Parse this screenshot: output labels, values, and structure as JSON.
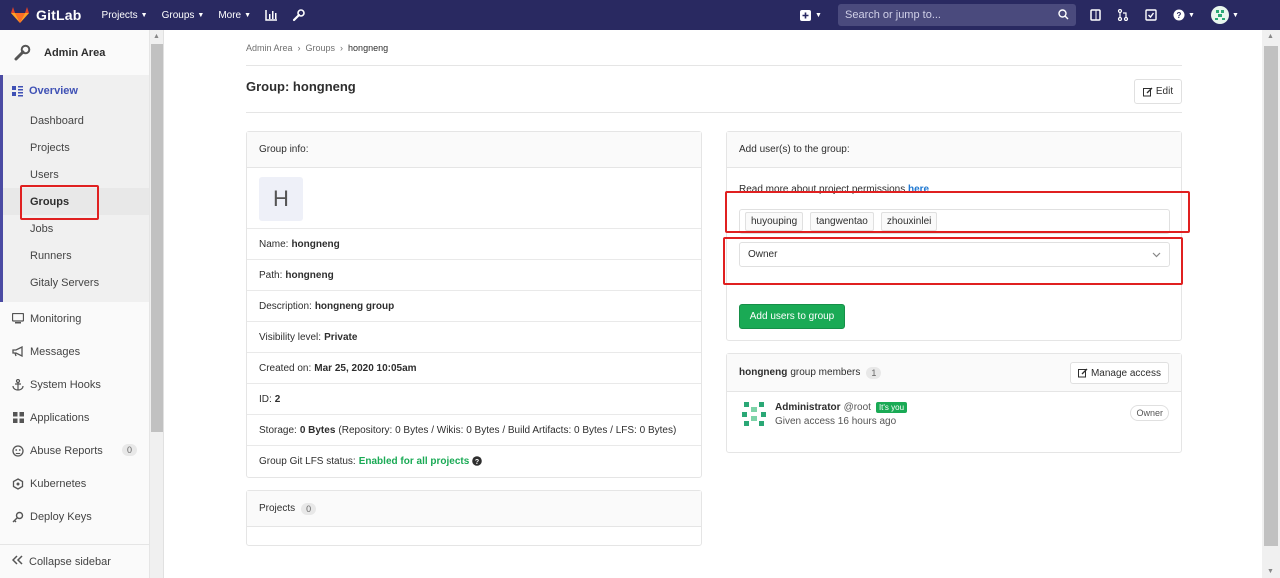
{
  "navbar": {
    "logo_text": "GitLab",
    "menu": [
      {
        "label": "Projects"
      },
      {
        "label": "Groups"
      },
      {
        "label": "More"
      }
    ],
    "search_placeholder": "Search or jump to..."
  },
  "sidebar": {
    "title": "Admin Area",
    "overview_label": "Overview",
    "overview_items": [
      {
        "label": "Dashboard"
      },
      {
        "label": "Projects"
      },
      {
        "label": "Users"
      },
      {
        "label": "Groups"
      },
      {
        "label": "Jobs"
      },
      {
        "label": "Runners"
      },
      {
        "label": "Gitaly Servers"
      }
    ],
    "items": [
      {
        "label": "Monitoring",
        "icon": "monitor-icon"
      },
      {
        "label": "Messages",
        "icon": "megaphone-icon"
      },
      {
        "label": "System Hooks",
        "icon": "anchor-icon"
      },
      {
        "label": "Applications",
        "icon": "grid-icon"
      },
      {
        "label": "Abuse Reports",
        "icon": "abuse-icon",
        "badge": "0"
      },
      {
        "label": "Kubernetes",
        "icon": "kubernetes-icon"
      },
      {
        "label": "Deploy Keys",
        "icon": "key-icon"
      }
    ],
    "collapse_label": "Collapse sidebar"
  },
  "breadcrumb": [
    "Admin Area",
    "Groups",
    "hongneng"
  ],
  "page": {
    "title": "Group: hongneng",
    "edit_label": "Edit"
  },
  "group_info": {
    "header": "Group info:",
    "avatar_letter": "H",
    "rows": [
      {
        "label": "Name:",
        "value": "hongneng"
      },
      {
        "label": "Path:",
        "value": "hongneng"
      },
      {
        "label": "Description:",
        "value": "hongneng group"
      },
      {
        "label": "Visibility level:",
        "value": "Private"
      },
      {
        "label": "Created on:",
        "value": "Mar 25, 2020 10:05am"
      },
      {
        "label": "ID:",
        "value": "2"
      }
    ],
    "storage_label": "Storage:",
    "storage_value": "0 Bytes",
    "storage_detail": "(Repository: 0 Bytes / Wikis: 0 Bytes / Build Artifacts: 0 Bytes / LFS: 0 Bytes)",
    "lfs_label": "Group Git LFS status:",
    "lfs_value": "Enabled for all projects"
  },
  "projects": {
    "label": "Projects",
    "count": "0"
  },
  "add_users": {
    "header": "Add user(s) to the group:",
    "perm_text": "Read more about project permissions",
    "perm_link": "here",
    "tokens": [
      "huyouping",
      "tangwentao",
      "zhouxinlei"
    ],
    "role": "Owner",
    "button_label": "Add users to group"
  },
  "members": {
    "group_name": "hongneng",
    "suffix": "group members",
    "count": "1",
    "manage_label": "Manage access",
    "list": [
      {
        "name": "Administrator",
        "username": "@root",
        "badge": "It's you",
        "access": "Given access 16 hours ago",
        "role": "Owner"
      }
    ]
  }
}
